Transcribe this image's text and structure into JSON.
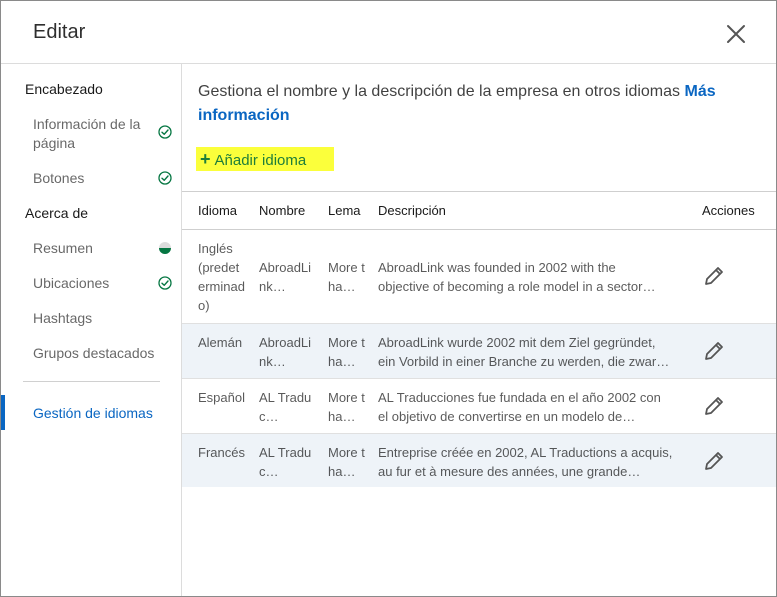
{
  "dialog": {
    "title": "Editar",
    "close_icon": "close-icon"
  },
  "sidebar": {
    "sections": [
      {
        "heading": "Encabezado",
        "items": [
          {
            "label": "Información de la página",
            "status": "check-circle-icon"
          },
          {
            "label": "Botones",
            "status": "check-circle-icon"
          }
        ]
      },
      {
        "heading": "Acerca de",
        "items": [
          {
            "label": "Resumen",
            "status": "half-circle-icon"
          },
          {
            "label": "Ubicaciones",
            "status": "check-circle-icon"
          },
          {
            "label": "Hashtags",
            "status": ""
          },
          {
            "label": "Grupos destacados",
            "status": ""
          }
        ]
      }
    ],
    "active_item": {
      "label": "Gestión de idiomas"
    }
  },
  "main": {
    "description": "Gestiona el nombre y la descripción de la empresa en otros idiomas",
    "more_info_link": "Más información",
    "add_button": {
      "icon": "plus-icon",
      "label": "Añadir idioma"
    },
    "table": {
      "columns": [
        "Idioma",
        "Nombre",
        "Lema",
        "Descripción",
        "Acciones"
      ],
      "rows": [
        {
          "idioma": "Inglés (predeterminado)",
          "nombre": "AbroadLink…",
          "lema": "More tha…",
          "descripcion_line1": "AbroadLink was founded in 2002 with the",
          "descripcion_line2": "objective of becoming a role model in a sector…"
        },
        {
          "idioma": "Alemán",
          "nombre": "AbroadLink…",
          "lema": "More tha…",
          "descripcion_line1": "AbroadLink wurde 2002 mit dem Ziel gegründet,",
          "descripcion_line2": "ein Vorbild in einer Branche zu werden, die zwar…"
        },
        {
          "idioma": "Español",
          "nombre": "AL Traduc…",
          "lema": "More tha…",
          "descripcion_line1": "AL Traducciones fue fundada en el año 2002 con",
          "descripcion_line2": "el objetivo de convertirse en un modelo de…"
        },
        {
          "idioma": "Francés",
          "nombre": "AL Traduc…",
          "lema": "More tha…",
          "descripcion_line1": "Entreprise créée en 2002, AL Traductions a acquis,",
          "descripcion_line2": "au fur et à mesure des années, une grande…"
        }
      ]
    }
  },
  "colors": {
    "accent": "#0a66c2",
    "success": "#057642",
    "highlight": "#fbff3b",
    "row_shade": "#eef3f8"
  }
}
